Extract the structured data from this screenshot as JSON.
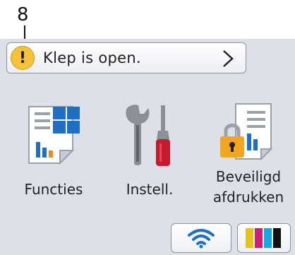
{
  "callout": {
    "number": "8"
  },
  "status": {
    "message": "Klep is open.",
    "icon": "warning-icon"
  },
  "apps": [
    {
      "label": "Functies",
      "icon": "functions-icon"
    },
    {
      "label": "Instell.",
      "icon": "wrench-screwdriver-icon"
    },
    {
      "label_line1": "Beveiligd",
      "label_line2": "afdrukken",
      "icon": "secure-print-icon"
    }
  ],
  "bottom": {
    "wifi_icon": "wifi-icon",
    "ink_icon": "ink-cartridges-icon"
  },
  "colors": {
    "accent_blue": "#1f6fc5",
    "warning_yellow": "#f5c23a",
    "ink": [
      "#e6c41e",
      "#d11c78",
      "#1aa6e0",
      "#111111"
    ]
  }
}
